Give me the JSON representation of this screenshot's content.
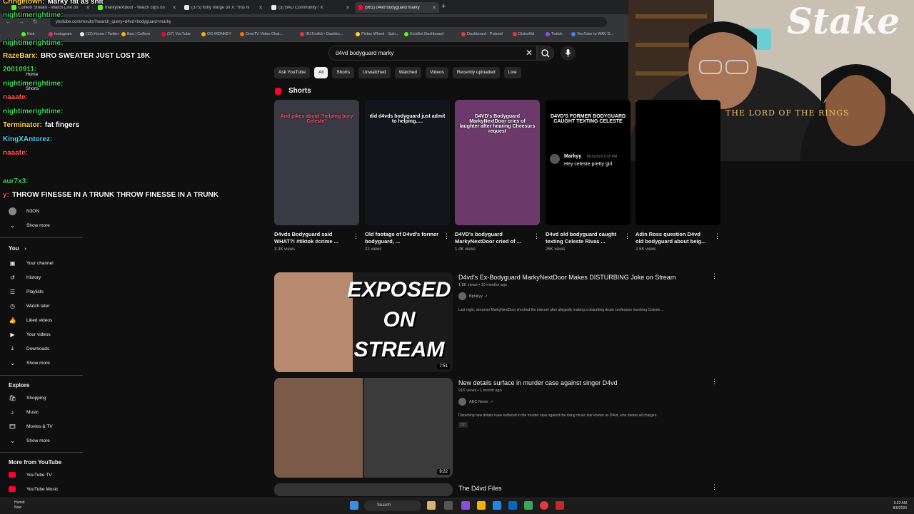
{
  "browser": {
    "tabs": [
      {
        "label": "Cuffem Stream - Watch Live on",
        "color": "#53fc18"
      },
      {
        "label": "markynextdoor - Watch clips on",
        "color": "#53fc18"
      },
      {
        "label": "(375) fishy minge on X: \"this ni",
        "color": "#e7e9ea"
      },
      {
        "label": "(3) BAU Community / X",
        "color": "#e7e9ea"
      },
      {
        "label": "(961) d4vd bodyguard marky",
        "color": "#ff0033"
      }
    ],
    "new_tab": "+",
    "url": "youtube.com/results?search_query=d4vd+bodyguard+marky",
    "bookmarks": [
      {
        "label": "Kick",
        "color": "#53fc18"
      },
      {
        "label": "Instagram",
        "color": "#e1306c"
      },
      {
        "label": "(12) Home / Twitter",
        "color": "#e7e9ea"
      },
      {
        "label": "Bau | Cuffem",
        "color": "#f4b400"
      },
      {
        "label": "(57) YouTube",
        "color": "#ff0033"
      },
      {
        "label": "OG MONKEY",
        "color": "#f4b400"
      },
      {
        "label": "OmeTV Video Chat...",
        "color": "#ff6d00"
      },
      {
        "label": "IRLToolkit • Dashbo...",
        "color": "#e53935"
      },
      {
        "label": "Picker Wheel - Spin...",
        "color": "#fdd835"
      },
      {
        "label": "KickBot Dashboard",
        "color": "#53fc18"
      },
      {
        "label": "Dashboard - Pulsoid",
        "color": "#e53935"
      },
      {
        "label": "DistroKid",
        "color": "#e53935"
      },
      {
        "label": "Twitch",
        "color": "#9146ff"
      },
      {
        "label": "YouTube to WAV D...",
        "color": "#4285f4"
      }
    ]
  },
  "search": {
    "query": "d4vd bodyguard marky",
    "clear": "✕",
    "search_icon": "search-icon",
    "mic_icon": "mic-icon"
  },
  "chips": [
    "Ask YouTube",
    "All",
    "Shorts",
    "Unwatched",
    "Watched",
    "Videos",
    "Recently uploaded",
    "Live"
  ],
  "selected_chip": "All",
  "chat": [
    {
      "user": "Cringetown:",
      "msg": "Marky fat as shit",
      "cls": "u"
    },
    {
      "user": "nightimerightime:",
      "msg": "",
      "cls": "u g"
    },
    {
      "user": "nightimerightime:",
      "msg": "",
      "cls": "u g"
    },
    {
      "user": "RazeBarx:",
      "msg": "BRO SWEATER JUST LOST 18K",
      "cls": "u"
    },
    {
      "user": "20010911:",
      "msg": "",
      "cls": "u g"
    },
    {
      "user": "nightimerightime:",
      "msg": "",
      "cls": "u g"
    },
    {
      "user": "naaate:",
      "msg": "",
      "cls": "u r"
    },
    {
      "user": "nightimerightime:",
      "msg": "",
      "cls": "u g"
    },
    {
      "user": "Terminator:",
      "msg": "fat fingers",
      "cls": "u"
    },
    {
      "user": "KingXAntorez:",
      "msg": "",
      "cls": "u c"
    },
    {
      "user": "naaate:",
      "msg": "",
      "cls": "u r"
    },
    {
      "user": "aur7x3:",
      "msg": "",
      "cls": "u g"
    },
    {
      "user": "y:",
      "msg": "THROW FINESSE IN A TRUNK THROW FINESSE IN A TRUNK",
      "cls": "u r"
    }
  ],
  "sidebar": {
    "top_items": [
      {
        "label": "Home"
      },
      {
        "label": "Shorts"
      }
    ],
    "sub_item": {
      "label": "N3ON"
    },
    "show_more": "Show more",
    "you_header": "You",
    "you_items": [
      {
        "label": "Your channel",
        "icon": "person-icon",
        "glyph": "▣"
      },
      {
        "label": "History",
        "icon": "history-icon",
        "glyph": "↺"
      },
      {
        "label": "Playlists",
        "icon": "playlists-icon",
        "glyph": "☰"
      },
      {
        "label": "Watch later",
        "icon": "clock-icon",
        "glyph": "◷"
      },
      {
        "label": "Liked videos",
        "icon": "thumbs-up-icon",
        "glyph": "👍"
      },
      {
        "label": "Your videos",
        "icon": "video-icon",
        "glyph": "▶"
      },
      {
        "label": "Downloads",
        "icon": "download-icon",
        "glyph": "⤓"
      },
      {
        "label": "Show more",
        "icon": "chevron-down-icon",
        "glyph": "⌄"
      }
    ],
    "explore_header": "Explore",
    "explore_items": [
      {
        "label": "Shopping",
        "icon": "shopping-bag-icon",
        "glyph": "🛍"
      },
      {
        "label": "Music",
        "icon": "music-note-icon",
        "glyph": "♪"
      },
      {
        "label": "Movies & TV",
        "icon": "film-icon",
        "glyph": "🎞"
      },
      {
        "label": "Show more",
        "icon": "chevron-down-icon",
        "glyph": "⌄"
      }
    ],
    "more_header": "More from YouTube",
    "more_items": [
      {
        "label": "YouTube TV",
        "icon": "youtube-tv-icon"
      },
      {
        "label": "YouTube Music",
        "icon": "youtube-music-icon"
      }
    ]
  },
  "shorts_section": {
    "title": "Shorts",
    "items": [
      {
        "caption": "And jokes about \"helping bury Celeste\"",
        "title": "D4vds Bodyguard said WHAT?! #tiktok #crime ...",
        "views": "3.3K views",
        "bg": "#3a3a44"
      },
      {
        "caption": "did d4vds bodyguard just admit to helping.....",
        "title": "Old footage of D4vd's former bodyguard, ...",
        "views": "22 views",
        "bg": "#14141c"
      },
      {
        "caption": "D4VD's Bodyguard MarkyNextDoor cries of laughter after hearing Cheesurs request",
        "title": "D4VD's bodyguard MarkyNextDoor cried of ...",
        "views": "1.4K views",
        "bg": "#6b3a6b"
      },
      {
        "caption": "D4VD'S FORMER BODYGUARD CAUGHT TEXTING CELESTE",
        "title": "D4vd old bodyguard caught texting Celeste Rivas ...",
        "views": "26K views",
        "bg": "#000000"
      },
      {
        "caption": "",
        "title": "Adin Ross question D4vd old bodyguard about beig...",
        "views": "2.5K views",
        "bg": "#000000"
      }
    ],
    "tweet": {
      "name": "Markyy",
      "date": "8/15/2022 9:35 PM",
      "text": "Hey celeste pretty girl"
    }
  },
  "videos": [
    {
      "title": "D4vd's Ex-Bodyguard MarkyNextDoor Makes DISTURBING Joke on Stream",
      "meta": "1.8K views • 10 months ago",
      "channel": "Bphillyy",
      "desc": "Last night, streamer MarkyNextDoor shocked the internet after allegedly making a disturbing drunk confession involving Celeste ...",
      "duration": "7:51",
      "thumb_text": "EXPOSED ON STREAM",
      "cc": ""
    },
    {
      "title": "New details surface in murder case against singer D4vd",
      "meta": "91K views • 1 month ago",
      "channel": "ABC News",
      "desc": "Disturbing new details have surfaced in the murder case against the rising music star known as D4vd, who denies all charges.",
      "duration": "9:22",
      "thumb_text": "",
      "cc": "CC"
    },
    {
      "title": "The D4vd Files",
      "meta": "",
      "channel": "",
      "desc": "",
      "duration": "",
      "thumb_text": "",
      "cc": ""
    }
  ],
  "webcam": {
    "brand": "Stake",
    "shirt_text": "THE LORD OF THE RINGS"
  },
  "taskbar": {
    "weather_line1": "Humid",
    "weather_line2": "Now",
    "search_label": "Search",
    "time": "5:23 AM",
    "date": "8/5/2026"
  }
}
